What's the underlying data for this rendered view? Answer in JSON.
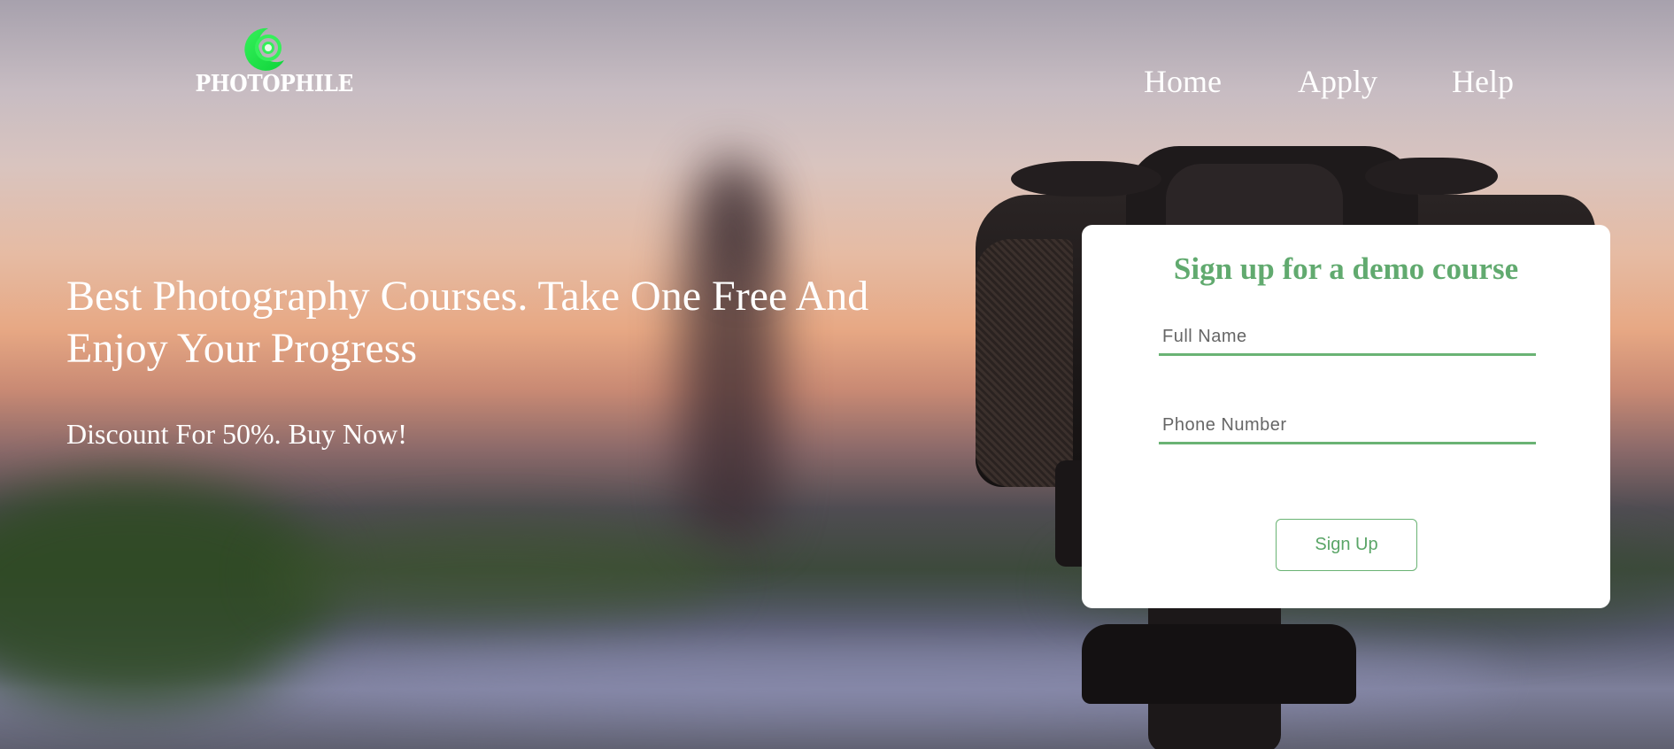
{
  "brand": {
    "name": "PHOTOPHILE",
    "logo_icon": "photophile-logo-icon",
    "accent_color": "#1ee84a"
  },
  "nav": {
    "items": [
      {
        "label": "Home"
      },
      {
        "label": "Apply"
      },
      {
        "label": "Help"
      }
    ]
  },
  "hero": {
    "title": "Best Photography Courses. Take One Free And Enjoy Your Progress",
    "subtitle": "Discount For 50%. Buy Now!"
  },
  "signup_form": {
    "title": "Sign up for a demo course",
    "full_name": {
      "value": "",
      "placeholder": "Full Name"
    },
    "phone_number": {
      "value": "",
      "placeholder": "Phone Number"
    },
    "submit_label": "Sign Up",
    "accent_color": "#61aa6f"
  }
}
